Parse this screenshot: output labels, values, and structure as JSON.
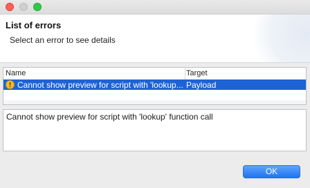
{
  "window": {
    "controls": [
      "close",
      "minimize",
      "maximize"
    ]
  },
  "header": {
    "title": "List of errors",
    "message": "Select an error to see details"
  },
  "table": {
    "columns": [
      "Name",
      "Target"
    ],
    "rows": [
      {
        "icon": "warning-icon",
        "name": "Cannot show preview for script with 'lookup...",
        "target": "Payload",
        "selected": true
      }
    ]
  },
  "details": {
    "text": "Cannot show preview for script with 'lookup' function call"
  },
  "footer": {
    "ok_label": "OK"
  },
  "colors": {
    "selection": "#1d63d6",
    "button": "#1f73f1",
    "warning": "#f2b824"
  }
}
